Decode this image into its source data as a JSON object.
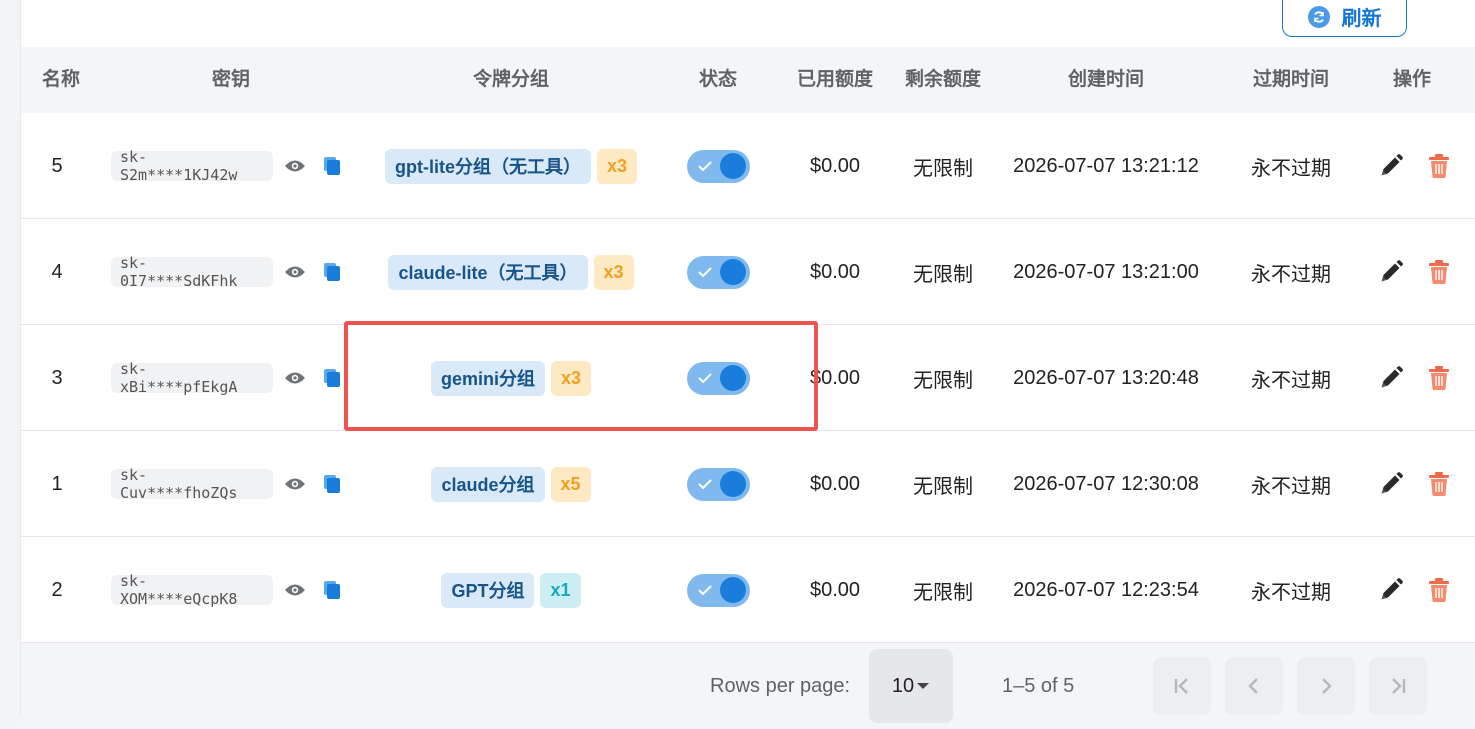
{
  "toolbar": {
    "refresh_label": "刷新"
  },
  "table": {
    "columns": {
      "name": "名称",
      "key": "密钥",
      "group": "令牌分组",
      "status": "状态",
      "used": "已用额度",
      "remaining": "剩余额度",
      "created": "创建时间",
      "expires": "过期时间",
      "actions": "操作"
    },
    "rows": [
      {
        "name": "5",
        "key": "sk-S2m****1KJ42w",
        "group": "gpt-lite分组（无工具）",
        "multiplier": "x3",
        "mult_color": "orange",
        "enabled": true,
        "used": "$0.00",
        "remaining": "无限制",
        "created": "2026-07-07 13:21:12",
        "expires": "永不过期"
      },
      {
        "name": "4",
        "key": "sk-0I7****SdKFhk",
        "group": "claude-lite（无工具）",
        "multiplier": "x3",
        "mult_color": "orange",
        "enabled": true,
        "used": "$0.00",
        "remaining": "无限制",
        "created": "2026-07-07 13:21:00",
        "expires": "永不过期"
      },
      {
        "name": "3",
        "key": "sk-xBi****pfEkgA",
        "group": "gemini分组",
        "multiplier": "x3",
        "mult_color": "orange",
        "enabled": true,
        "used": "$0.00",
        "remaining": "无限制",
        "created": "2026-07-07 13:20:48",
        "expires": "永不过期"
      },
      {
        "name": "1",
        "key": "sk-Cuv****fhoZQs",
        "group": "claude分组",
        "multiplier": "x5",
        "mult_color": "orange",
        "enabled": true,
        "used": "$0.00",
        "remaining": "无限制",
        "created": "2026-07-07 12:30:08",
        "expires": "永不过期"
      },
      {
        "name": "2",
        "key": "sk-XOM****eQcpK8",
        "group": "GPT分组",
        "multiplier": "x1",
        "mult_color": "cyan",
        "enabled": true,
        "used": "$0.00",
        "remaining": "无限制",
        "created": "2026-07-07 12:23:54",
        "expires": "永不过期"
      }
    ]
  },
  "pagination": {
    "rows_per_page_label": "Rows per page:",
    "rows_per_page_value": "10",
    "range_text": "1–5 of 5"
  },
  "colors": {
    "accent": "#1677d2",
    "group_chip_bg": "#d9e9f8",
    "mult_orange_bg": "#fde9c4",
    "mult_orange_fg": "#f0a020",
    "mult_cyan_bg": "#cdeff4",
    "mult_cyan_fg": "#1aa7c2",
    "delete_red": "#ef6a4a",
    "highlight_red": "#ef5350"
  }
}
